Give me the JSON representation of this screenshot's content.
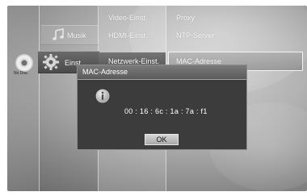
{
  "status": {
    "disc": "No Disc"
  },
  "menu": {
    "level1": [
      {
        "id": "musik",
        "label": "Musik",
        "icon": "music-note-icon"
      },
      {
        "id": "einst",
        "label": "Einst.",
        "icon": "gear-icon",
        "selected": true
      }
    ],
    "level2": [
      {
        "label": "Video-Einst."
      },
      {
        "label": "HDMI-Einst."
      },
      {
        "label": "Netzwerk-Einst.",
        "selected": true
      }
    ],
    "level3": [
      {
        "label": "Proxy"
      },
      {
        "label": "NTP-Server"
      },
      {
        "label": "MAC-Adresse",
        "selected": true
      }
    ]
  },
  "dialog": {
    "title": "MAC-Adresse",
    "icon": "info-icon",
    "mac": "00 : 16 : 6c : 1a : 7a : f1",
    "ok_label": "OK"
  }
}
